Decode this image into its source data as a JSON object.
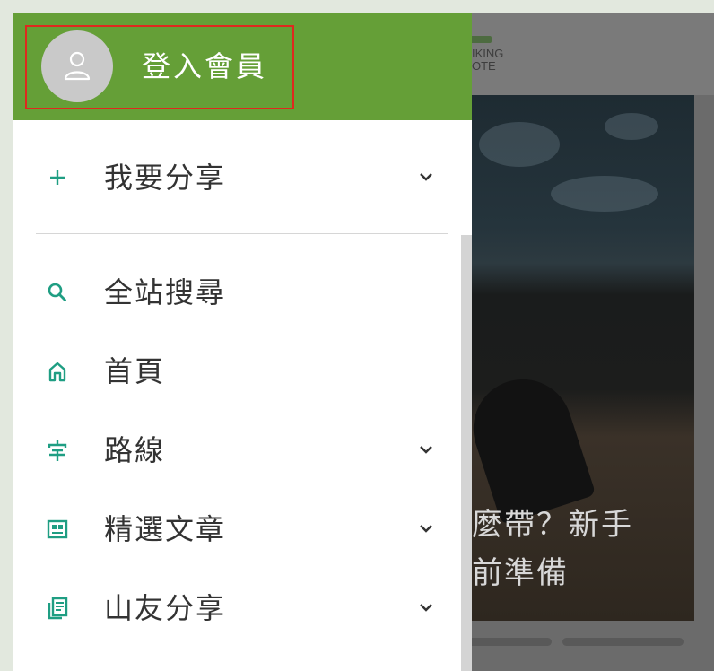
{
  "login": {
    "label": "登入會員",
    "avatar_icon": "user-icon"
  },
  "menu": [
    {
      "label": "我要分享",
      "icon": "plus-icon",
      "has_submenu": true
    },
    {
      "label": "全站搜尋",
      "icon": "search-icon",
      "has_submenu": false
    },
    {
      "label": "首頁",
      "icon": "home-icon",
      "has_submenu": false
    },
    {
      "label": "路線",
      "icon": "trail-icon",
      "has_submenu": true
    },
    {
      "label": "精選文章",
      "icon": "article-icon",
      "has_submenu": true
    },
    {
      "label": "山友分享",
      "icon": "posts-icon",
      "has_submenu": true
    }
  ],
  "background_page": {
    "logo_line1": "IKING",
    "logo_line2": "OTE",
    "hero_title_line1": "麼帶？新手",
    "hero_title_line2": "前準備"
  },
  "colors": {
    "header_green": "#659f37",
    "icon_teal": "#1f9e83",
    "highlight_red": "#e0281e"
  }
}
